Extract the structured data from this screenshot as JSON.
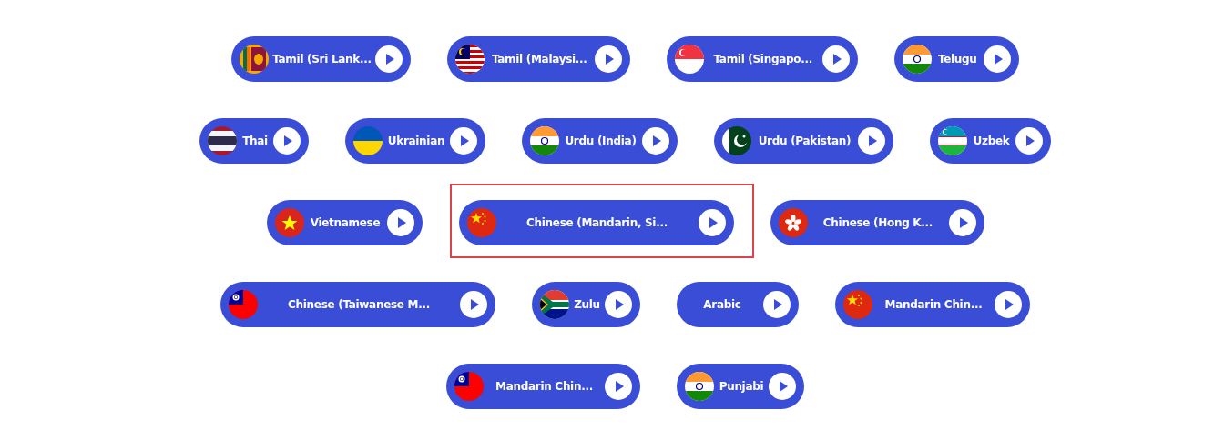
{
  "rows": [
    {
      "buttons": [
        {
          "label": "Tamil (Sri Lank...",
          "kind": "sri-lanka",
          "highlighted": false
        },
        {
          "label": "Tamil (Malaysi...",
          "kind": "malaysia",
          "highlighted": false
        },
        {
          "label": "Tamil (Singapo...",
          "kind": "singapore",
          "highlighted": false
        },
        {
          "label": "Telugu",
          "kind": "india",
          "highlighted": false
        }
      ]
    },
    {
      "buttons": [
        {
          "label": "Thai",
          "kind": "thailand",
          "highlighted": false
        },
        {
          "label": "Ukrainian",
          "kind": "ukraine",
          "highlighted": false
        },
        {
          "label": "Urdu (India)",
          "kind": "india",
          "highlighted": false
        },
        {
          "label": "Urdu (Pakistan)",
          "kind": "pakistan",
          "highlighted": false
        },
        {
          "label": "Uzbek",
          "kind": "uzbekistan",
          "highlighted": false
        }
      ]
    },
    {
      "buttons": [
        {
          "label": "Vietnamese",
          "kind": "vietnam",
          "highlighted": false
        },
        {
          "label": "Chinese (Mandarin, Si...",
          "kind": "china",
          "highlighted": true
        },
        {
          "label": "Chinese (Hong K...",
          "kind": "hong-kong",
          "highlighted": false
        }
      ]
    },
    {
      "buttons": [
        {
          "label": "Chinese (Taiwanese M...",
          "kind": "taiwan",
          "highlighted": false
        },
        {
          "label": "Zulu",
          "kind": "south-africa",
          "highlighted": false
        },
        {
          "label": "Arabic",
          "kind": "none",
          "highlighted": false
        },
        {
          "label": "Mandarin Chin...",
          "kind": "china",
          "highlighted": false
        }
      ]
    },
    {
      "buttons": [
        {
          "label": "Mandarin Chin...",
          "kind": "taiwan",
          "highlighted": false
        },
        {
          "label": "Punjabi",
          "kind": "india",
          "highlighted": false
        }
      ]
    }
  ]
}
